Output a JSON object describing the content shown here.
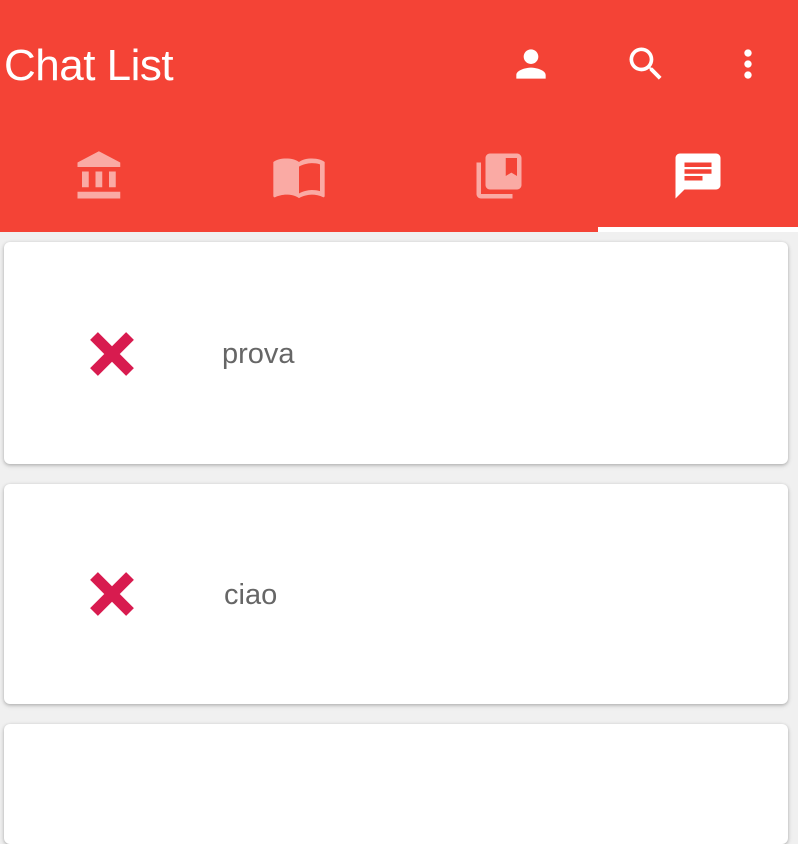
{
  "header": {
    "title": "Chat List",
    "actions": [
      {
        "icon": "person-icon"
      },
      {
        "icon": "search-icon"
      },
      {
        "icon": "more-vert-icon"
      }
    ],
    "background": "#f44336"
  },
  "tabs": [
    {
      "icon": "bank-icon",
      "selected": false
    },
    {
      "icon": "book-icon",
      "selected": false
    },
    {
      "icon": "library-books-icon",
      "selected": false
    },
    {
      "icon": "chat-icon",
      "selected": true
    }
  ],
  "chats": [
    {
      "name": "prova",
      "delete_icon": "close-icon"
    },
    {
      "name": "ciao",
      "delete_icon": "close-icon"
    },
    {
      "name": "",
      "delete_icon": ""
    }
  ],
  "colors": {
    "accent": "#f44336",
    "delete": "#d81b4f",
    "text": "#666666"
  }
}
